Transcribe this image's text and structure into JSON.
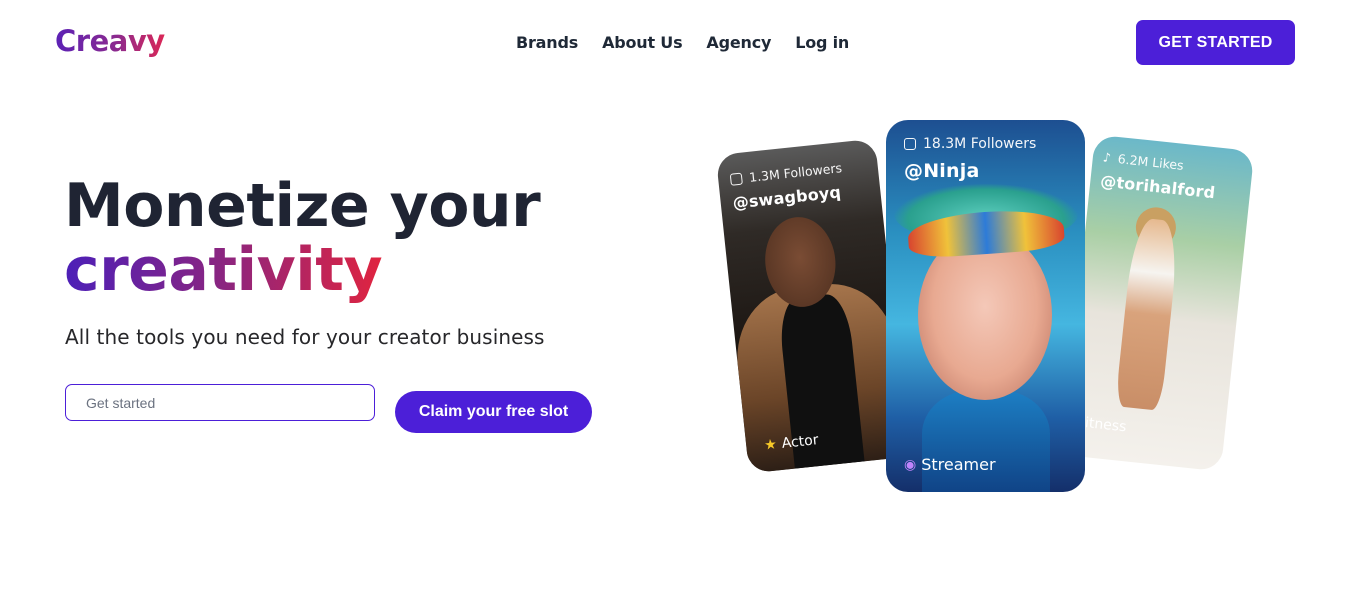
{
  "header": {
    "logo": "Creavy",
    "nav": [
      "Brands",
      "About Us",
      "Agency",
      "Log in"
    ],
    "cta": "GET STARTED"
  },
  "hero": {
    "title_line1": "Monetize your",
    "title_line2": "creativity",
    "subtitle": "All the tools you need for your creator business",
    "email_placeholder": "Get started",
    "claim_label": "Claim your free slot"
  },
  "cards": {
    "left": {
      "followers": "1.3M Followers",
      "handle": "@swagboyq",
      "tag": "Actor",
      "platform_icon": "instagram-icon",
      "tag_icon": "star-icon"
    },
    "center": {
      "followers": "18.3M Followers",
      "handle": "@Ninja",
      "tag": "Streamer",
      "platform_icon": "twitch-icon",
      "tag_icon": "gamepad-icon"
    },
    "right": {
      "followers": "6.2M Likes",
      "handle": "@torihalford",
      "tag": "itness",
      "platform_icon": "tiktok-icon"
    }
  },
  "colors": {
    "accent": "#4c1fd8",
    "gradient_start": "#4c1fb8",
    "gradient_end": "#e0243f"
  }
}
